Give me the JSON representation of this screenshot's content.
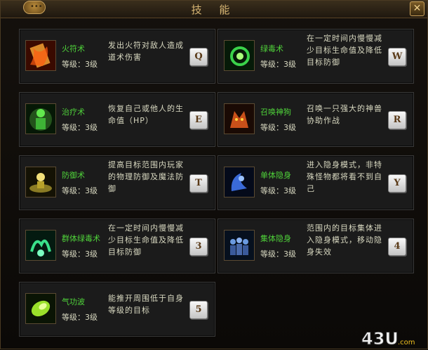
{
  "window": {
    "title": "技 能"
  },
  "level_label": "等级：3级",
  "skills": [
    {
      "name": "火符术",
      "level": "等级：3级",
      "desc": "发出火符对敌人造成道术伤害",
      "key": "Q",
      "icon": "fire-talisman-icon"
    },
    {
      "name": "绿毒术",
      "level": "等级：3级",
      "desc": "在一定时间内慢慢减少目标生命值及降低目标防御",
      "key": "W",
      "icon": "green-poison-icon"
    },
    {
      "name": "治疗术",
      "level": "等级：3级",
      "desc": "恢复自己或他人的生命值（HP）",
      "key": "E",
      "icon": "healing-icon"
    },
    {
      "name": "召唤神狗",
      "level": "等级：3级",
      "desc": "召唤一只强大的神兽协助作战",
      "key": "R",
      "icon": "summon-beast-icon"
    },
    {
      "name": "防御术",
      "level": "等级：3级",
      "desc": "提高目标范围内玩家的物理防御及魔法防御",
      "key": "T",
      "icon": "defense-icon"
    },
    {
      "name": "单体隐身",
      "level": "等级：3级",
      "desc": "进入隐身模式，非特殊怪物都将看不到自己",
      "key": "Y",
      "icon": "stealth-icon"
    },
    {
      "name": "群体绿毒术",
      "level": "等级：3级",
      "desc": "在一定时间内慢慢减少目标生命值及降低目标防御",
      "key": "3",
      "icon": "mass-poison-icon"
    },
    {
      "name": "集体隐身",
      "level": "等级：3级",
      "desc": "范围内的目标集体进入隐身模式，移动隐身失效",
      "key": "4",
      "icon": "group-stealth-icon"
    },
    {
      "name": "气功波",
      "level": "等级：3级",
      "desc": "能推开周围低于自身等级的目标",
      "key": "5",
      "icon": "qigong-wave-icon"
    }
  ],
  "logo": {
    "text": "43U",
    "suffix": ".com"
  }
}
